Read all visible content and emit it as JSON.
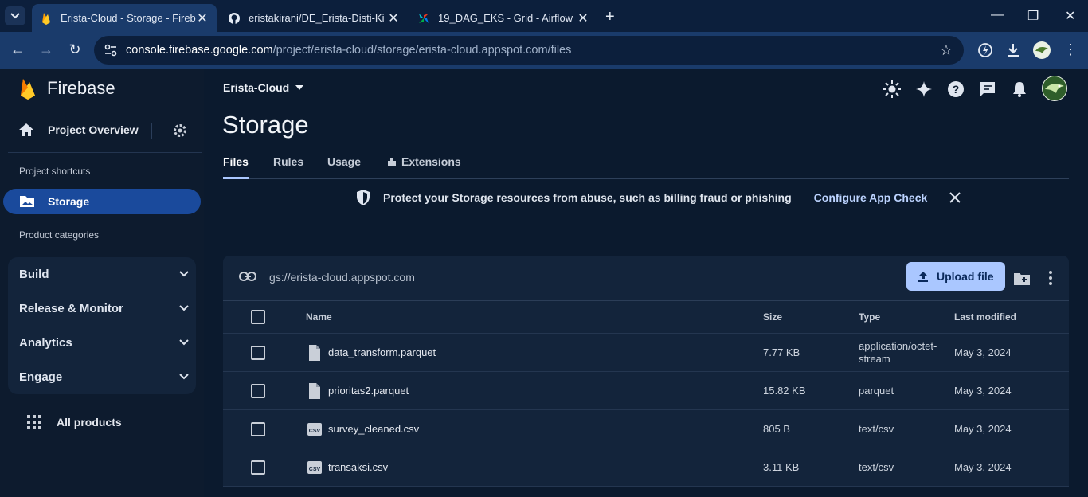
{
  "browser": {
    "tabs": [
      {
        "title": "Erista-Cloud - Storage - Firebase",
        "active": true
      },
      {
        "title": "eristakirani/DE_Erista-Disti-Kirani",
        "active": false
      },
      {
        "title": "19_DAG_EKS - Grid - Airflow",
        "active": false
      }
    ],
    "url_host": "console.firebase.google.com",
    "url_path": "/project/erista-cloud/storage/erista-cloud.appspot.com/files"
  },
  "sidebar": {
    "brand": "Firebase",
    "project_overview": "Project Overview",
    "shortcuts_label": "Project shortcuts",
    "active_item": "Storage",
    "categories_label": "Product categories",
    "categories": [
      "Build",
      "Release & Monitor",
      "Analytics",
      "Engage"
    ],
    "all_products": "All products"
  },
  "header": {
    "project_name": "Erista-Cloud",
    "page_title": "Storage",
    "tabs": [
      "Files",
      "Rules",
      "Usage",
      "Extensions"
    ],
    "active_tab": "Files"
  },
  "banner": {
    "message": "Protect your Storage resources from abuse, such as billing fraud or phishing",
    "cta": "Configure App Check"
  },
  "files": {
    "bucket": "gs://erista-cloud.appspot.com",
    "upload_label": "Upload file",
    "columns": {
      "name": "Name",
      "size": "Size",
      "type": "Type",
      "modified": "Last modified"
    },
    "rows": [
      {
        "name": "data_transform.parquet",
        "size": "7.77 KB",
        "type1": "application/octet-",
        "type2": "stream",
        "modified": "May 3, 2024",
        "icon": "file-icon"
      },
      {
        "name": "prioritas2.parquet",
        "size": "15.82 KB",
        "type1": "parquet",
        "type2": "",
        "modified": "May 3, 2024",
        "icon": "file-icon"
      },
      {
        "name": "survey_cleaned.csv",
        "size": "805 B",
        "type1": "text/csv",
        "type2": "",
        "modified": "May 3, 2024",
        "icon": "csv-icon"
      },
      {
        "name": "transaksi.csv",
        "size": "3.11 KB",
        "type1": "text/csv",
        "type2": "",
        "modified": "May 3, 2024",
        "icon": "csv-icon"
      }
    ]
  },
  "colors": {
    "accent": "#aac7ff",
    "active_nav": "#1a4a9c",
    "background": "#0b1a2e"
  }
}
